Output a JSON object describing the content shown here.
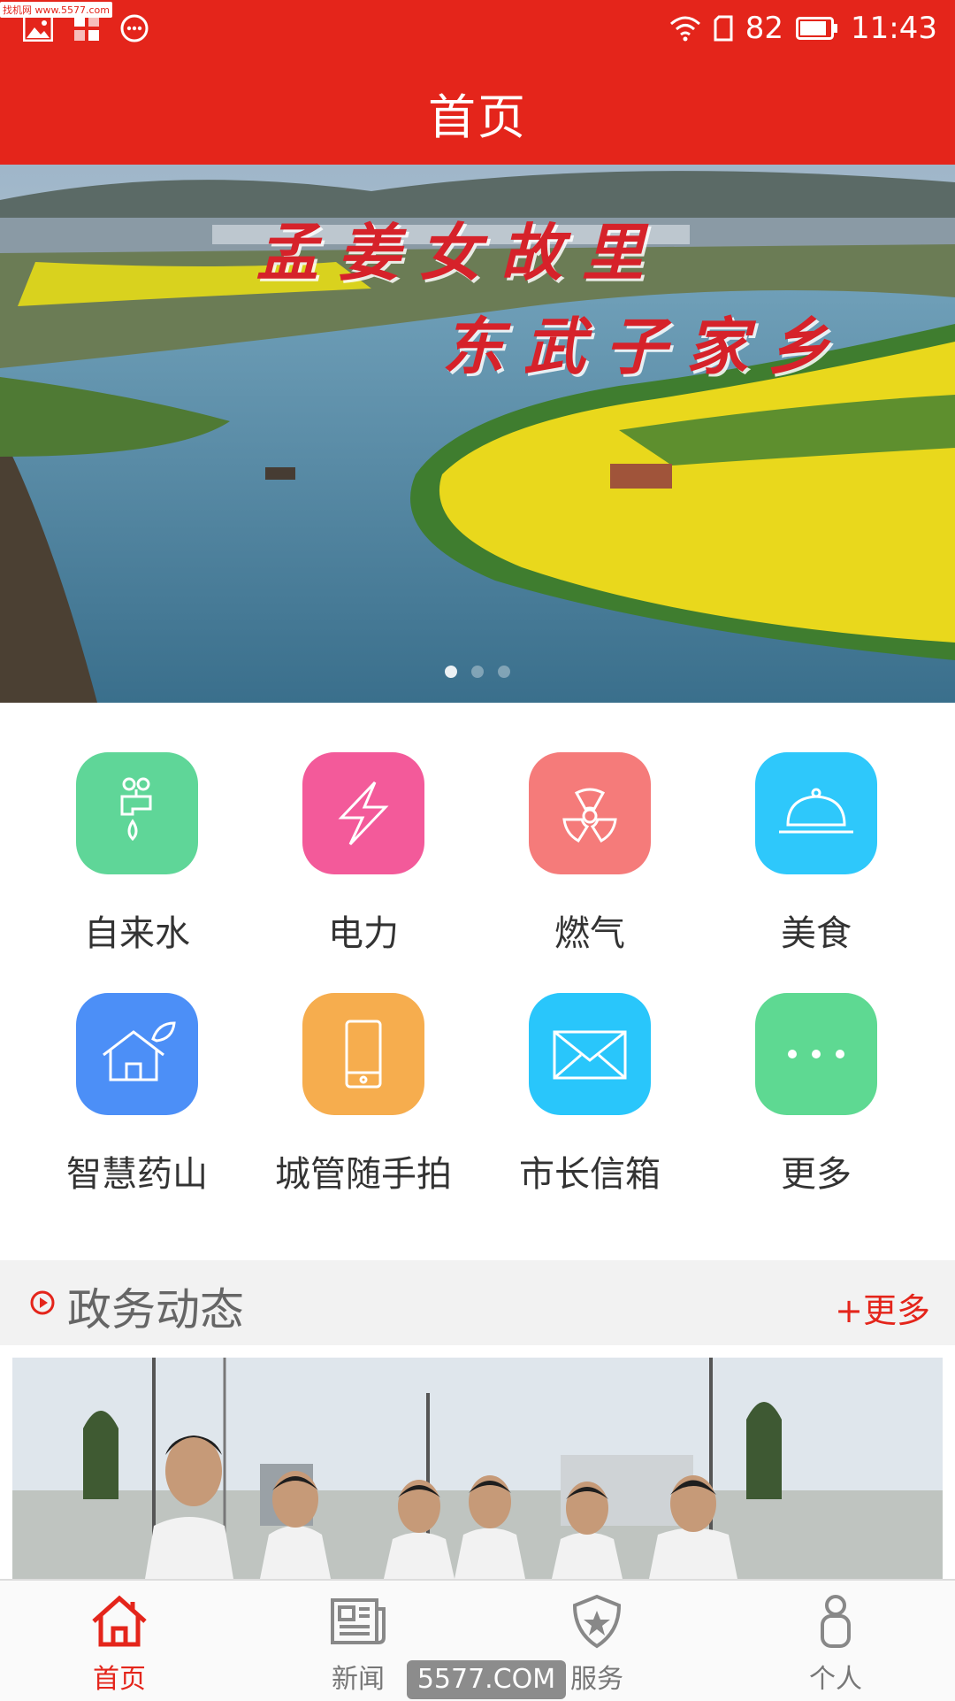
{
  "watermark_site": "找机网 www.5577.com",
  "status": {
    "battery": "82",
    "time": "11:43"
  },
  "header": {
    "title": "首页"
  },
  "banner": {
    "line1": "孟姜女故里",
    "line2": "东武子家乡",
    "slides": 3,
    "active_slide": 0
  },
  "services": [
    {
      "label": "自来水",
      "icon": "tap-water-icon",
      "color": "#5fd698"
    },
    {
      "label": "电力",
      "icon": "lightning-icon",
      "color": "#f35a9a"
    },
    {
      "label": "燃气",
      "icon": "radiation-icon",
      "color": "#f57b7a"
    },
    {
      "label": "美食",
      "icon": "food-cloche-icon",
      "color": "#2ec8fb"
    },
    {
      "label": "智慧药山",
      "icon": "eco-house-icon",
      "color": "#4c8ff7"
    },
    {
      "label": "城管随手拍",
      "icon": "mobile-phone-icon",
      "color": "#f6ad4e"
    },
    {
      "label": "市长信箱",
      "icon": "envelope-icon",
      "color": "#29c6fb"
    },
    {
      "label": "更多",
      "icon": "more-dots-icon",
      "color": "#5ed992"
    }
  ],
  "section": {
    "title": "政务动态",
    "more": "+更多"
  },
  "tabs": [
    {
      "label": "首页",
      "icon": "home-icon",
      "active": true
    },
    {
      "label": "新闻",
      "icon": "newspaper-icon",
      "active": false
    },
    {
      "label": "服务",
      "icon": "badge-star-icon",
      "active": false
    },
    {
      "label": "个人",
      "icon": "person-icon",
      "active": false
    }
  ],
  "bottom_watermark": "5577.COM"
}
